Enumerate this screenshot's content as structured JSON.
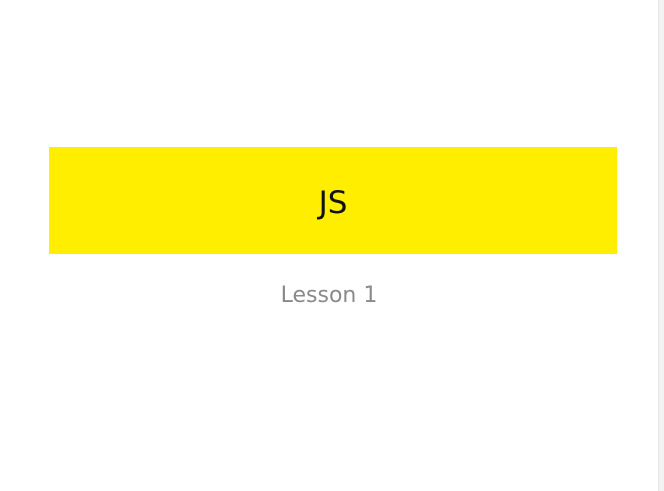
{
  "slide": {
    "title": "JS",
    "subtitle": "Lesson 1"
  },
  "colors": {
    "title_band": "#ffee00",
    "title_text": "#111111",
    "subtitle_text": "#8a8a8a",
    "background": "#ffffff"
  }
}
